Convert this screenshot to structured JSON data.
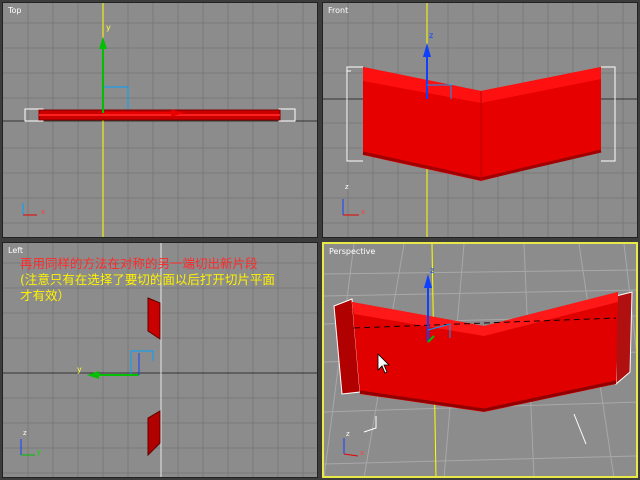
{
  "viewports": {
    "top": {
      "label": "Top"
    },
    "front": {
      "label": "Front"
    },
    "left": {
      "label": "Left"
    },
    "perspective": {
      "label": "Perspective"
    }
  },
  "axes": {
    "x": "x",
    "y": "y",
    "z": "z"
  },
  "instructions": {
    "line1": "再用同样的方法在对称的另一端切出新片段",
    "line2": "(注意只有在选择了要切的面以后打开切片平面",
    "line3": "才有效）"
  },
  "colors": {
    "viewport_bg": "#8c8c8c",
    "active_border": "#e8e84a",
    "object_red": "#e00000",
    "note_red": "#ff2a2a",
    "note_yellow": "#fff200"
  },
  "icons": [
    "mouse-cursor-icon",
    "axis-tripod-icon",
    "transform-gizmo-icon"
  ]
}
